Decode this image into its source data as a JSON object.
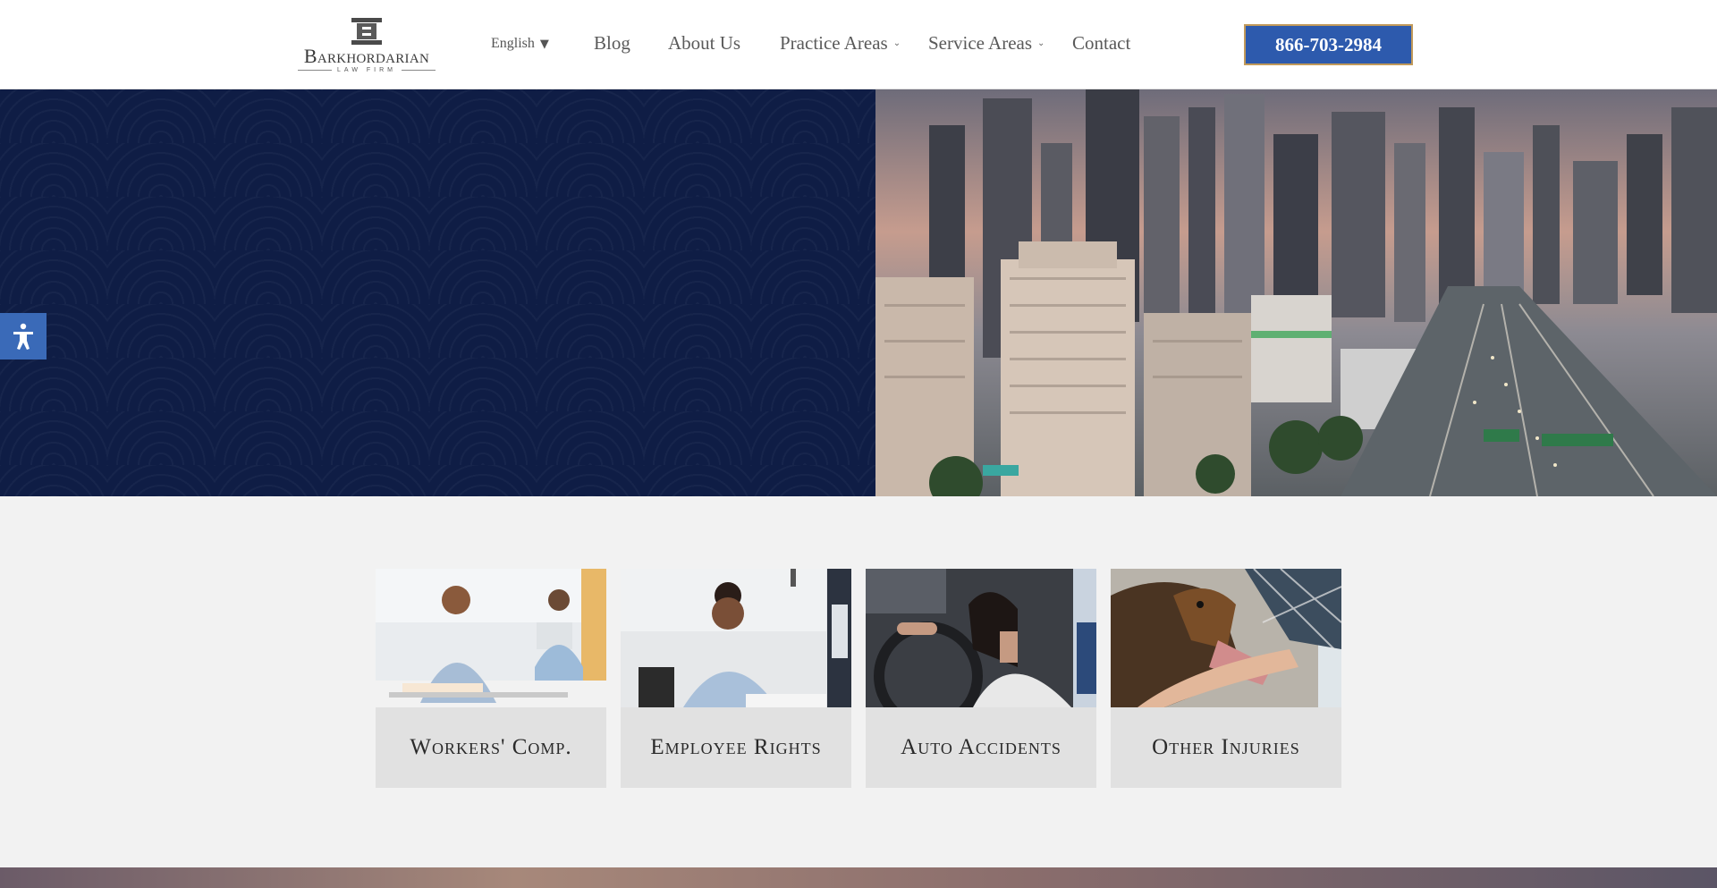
{
  "header": {
    "logo": {
      "name": "Barkhordarian",
      "subtitle": "LAW FIRM"
    },
    "language": {
      "label": "English",
      "arrow": "▼"
    },
    "nav": [
      {
        "label": "Blog",
        "has_dropdown": false
      },
      {
        "label": "About Us",
        "has_dropdown": false
      },
      {
        "label": "Practice Areas",
        "has_dropdown": true
      },
      {
        "label": "Service Areas",
        "has_dropdown": true
      },
      {
        "label": "Contact",
        "has_dropdown": false
      }
    ],
    "phone": "866-703-2984"
  },
  "accessibility": {
    "icon": "accessibility-icon"
  },
  "cards": [
    {
      "label": "Workers' Comp."
    },
    {
      "label": "Employee Rights"
    },
    {
      "label": "Auto Accidents"
    },
    {
      "label": "Other Injuries"
    }
  ],
  "colors": {
    "navy": "#0f1d45",
    "accent_blue": "#2d5aad",
    "gold_border": "#c29a5a",
    "card_bg": "#e1e1e1"
  }
}
